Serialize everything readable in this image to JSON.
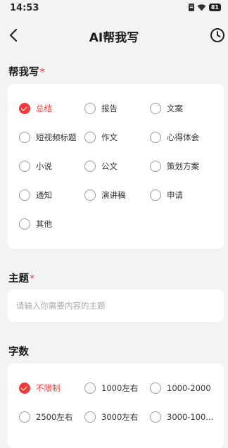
{
  "status_bar": {
    "time": "14:53",
    "battery": "81"
  },
  "nav": {
    "title": "AI帮我写",
    "back_icon": "arrow-left-icon",
    "history_icon": "clock-icon"
  },
  "write_section": {
    "title": "帮我写",
    "required_mark": "*",
    "options": [
      {
        "label": "总结",
        "selected": true
      },
      {
        "label": "报告",
        "selected": false
      },
      {
        "label": "文案",
        "selected": false
      },
      {
        "label": "短视频标题",
        "selected": false
      },
      {
        "label": "作文",
        "selected": false
      },
      {
        "label": "心得体会",
        "selected": false
      },
      {
        "label": "小说",
        "selected": false
      },
      {
        "label": "公文",
        "selected": false
      },
      {
        "label": "策划方案",
        "selected": false
      },
      {
        "label": "通知",
        "selected": false
      },
      {
        "label": "演讲稿",
        "selected": false
      },
      {
        "label": "申请",
        "selected": false
      },
      {
        "label": "其他",
        "selected": false
      }
    ]
  },
  "topic_section": {
    "title": "主题",
    "required_mark": "*",
    "input_value": "",
    "placeholder": "请输入你需要内容的主题"
  },
  "word_count_section": {
    "title": "字数",
    "options": [
      {
        "label": "不限制",
        "selected": true
      },
      {
        "label": "1000左右",
        "selected": false
      },
      {
        "label": "1000-2000",
        "selected": false
      },
      {
        "label": "2500左右",
        "selected": false
      },
      {
        "label": "3000左右",
        "selected": false
      },
      {
        "label": "3000-100...",
        "selected": false
      }
    ]
  },
  "colors": {
    "accent": "#ef3b3b",
    "background": "#f2f3f5",
    "card": "#ffffff"
  }
}
